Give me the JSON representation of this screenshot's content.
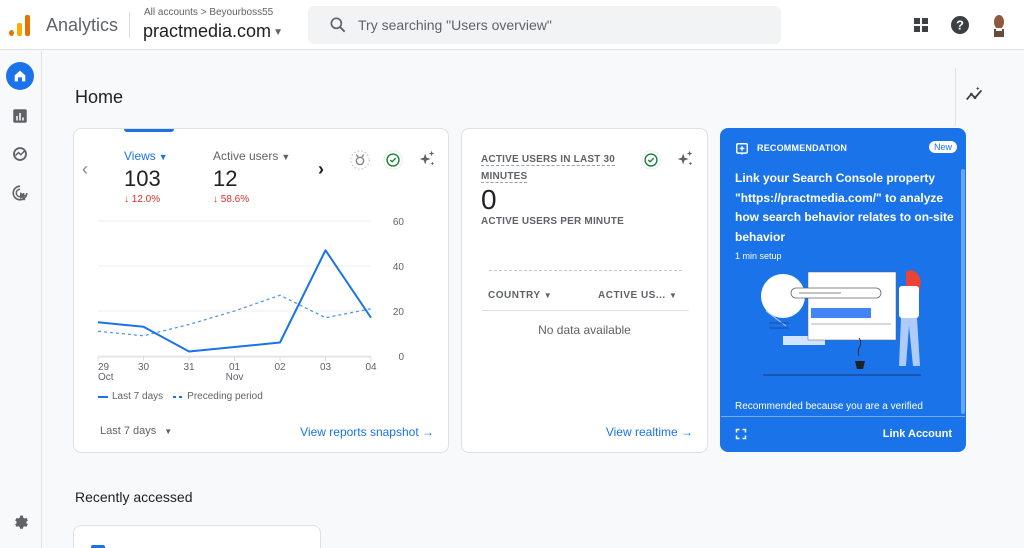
{
  "header": {
    "app_name": "Analytics",
    "breadcrumb": "All accounts > Beyourboss55",
    "property": "practmedia.com",
    "search_placeholder": "Try searching \"Users overview\"",
    "icons": [
      "apps-grid-icon",
      "help-icon",
      "account-avatar"
    ]
  },
  "sidebar": {
    "items": [
      {
        "name": "home",
        "icon": "home-icon",
        "active": true
      },
      {
        "name": "reports",
        "icon": "bar-chart-icon",
        "active": false
      },
      {
        "name": "explore",
        "icon": "explore-icon",
        "active": false
      },
      {
        "name": "advertising",
        "icon": "advertising-cursor-icon",
        "active": false
      }
    ],
    "settings_icon": "gear-icon"
  },
  "main": {
    "title": "Home",
    "recently_accessed_title": "Recently accessed"
  },
  "overview_card": {
    "metrics": [
      {
        "label": "Views",
        "value": "103",
        "delta": "↓ 12.0%",
        "selected": true
      },
      {
        "label": "Active users",
        "value": "12",
        "delta": "↓ 58.6%",
        "selected": false
      }
    ],
    "legend": {
      "current": "Last 7 days",
      "previous": "Preceding period"
    },
    "date_range": "Last 7 days",
    "link": "View reports snapshot"
  },
  "chart_data": {
    "type": "line",
    "title": "",
    "xlabel": "",
    "ylabel": "",
    "x": [
      "29 Oct",
      "30",
      "31",
      "01 Nov",
      "02",
      "03",
      "04"
    ],
    "x_tick_top": [
      "29",
      "30",
      "31",
      "01",
      "02",
      "03",
      "04"
    ],
    "x_tick_bottom": [
      "Oct",
      "",
      "",
      "Nov",
      "",
      "",
      ""
    ],
    "y_ticks": [
      0,
      20,
      40,
      60
    ],
    "ylim": [
      0,
      60
    ],
    "y_axis_side": "right",
    "grid": true,
    "legend_position": "bottom-left",
    "series": [
      {
        "name": "Last 7 days",
        "style": "solid",
        "color": "#1a73e8",
        "values": [
          15,
          13,
          2,
          4,
          6,
          47,
          17
        ]
      },
      {
        "name": "Preceding period",
        "style": "dashed",
        "color": "#1a73e8",
        "values": [
          11,
          9,
          14,
          20,
          27,
          17,
          21
        ]
      }
    ]
  },
  "realtime_card": {
    "title": "ACTIVE USERS IN LAST 30 MINUTES",
    "title_line1": "ACTIVE USERS IN LAST 30",
    "title_line2": "MINUTES",
    "value": "0",
    "subtitle": "ACTIVE USERS PER MINUTE",
    "columns": [
      "COUNTRY",
      "ACTIVE US..."
    ],
    "empty_text": "No data available",
    "link": "View realtime"
  },
  "recommendation_card": {
    "label": "RECOMMENDATION",
    "badge": "New",
    "text": "Link your Search Console property \"https://practmedia.com/\" to analyze how search behavior relates to on-site behavior",
    "setup": "1 min setup",
    "reason": "Recommended because you are a verified",
    "action": "Link Account"
  },
  "colors": {
    "accent": "#1a73e8",
    "negative": "#d93025",
    "logo_orange": "#f9ab00",
    "logo_dark_orange": "#e37400"
  }
}
